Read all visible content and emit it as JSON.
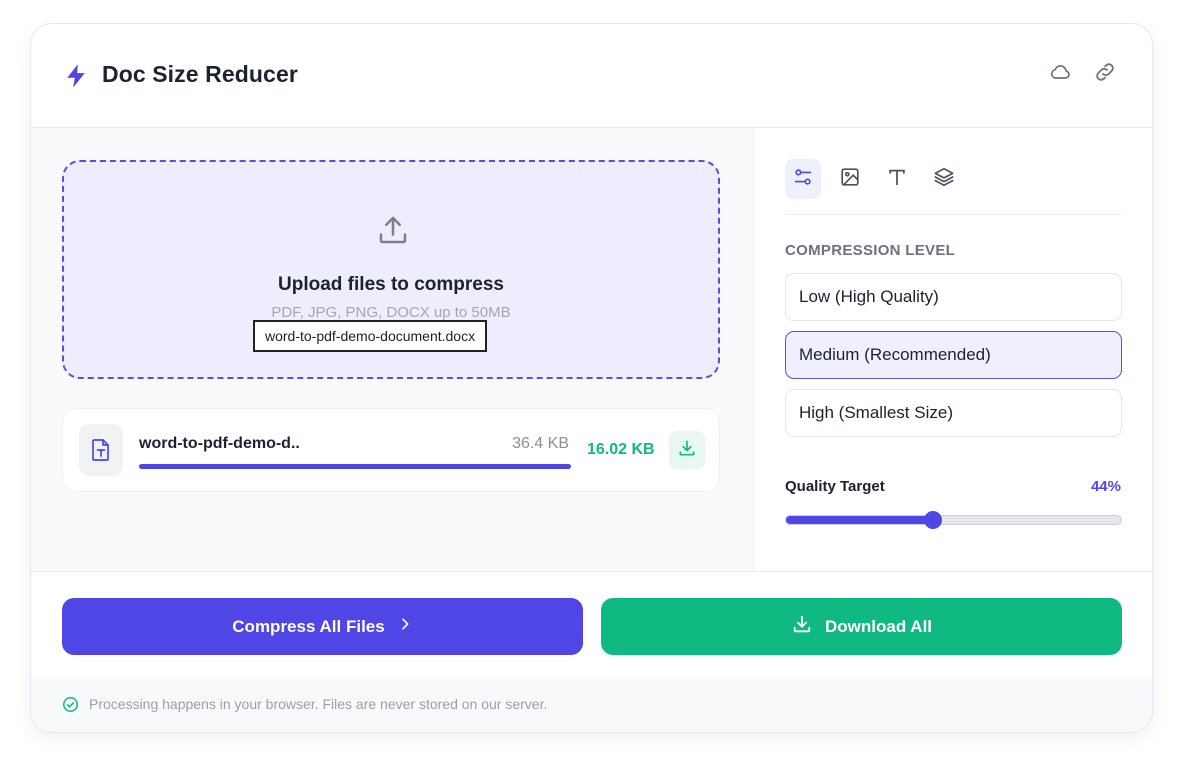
{
  "app": {
    "title": "Doc Size Reducer",
    "accent_color": "#4f46e5",
    "success_color": "#10b981",
    "header_icons": [
      "cloud-icon",
      "link-icon"
    ]
  },
  "upload": {
    "title": "Upload files to compress",
    "subtitle": "PDF, JPG, PNG, DOCX up to 50MB",
    "selected_file": "word-to-pdf-demo-document.docx"
  },
  "files": [
    {
      "name": "word-to-pdf-demo-d..",
      "original_size": "36.4 KB",
      "compressed_size": "16.02 KB",
      "progress_percent": 100
    }
  ],
  "settings": {
    "tabs": [
      "sliders-icon",
      "image-icon",
      "text-icon",
      "layers-icon"
    ],
    "active_tab": 0,
    "compression_label": "COMPRESSION LEVEL",
    "options": [
      "Low (High Quality)",
      "Medium (Recommended)",
      "High (Smallest Size)"
    ],
    "selected_option": 1,
    "quality_label": "Quality Target",
    "quality_value": "44%",
    "quality_percent": 44
  },
  "actions": {
    "compress_label": "Compress All Files",
    "download_label": "Download All"
  },
  "footer": {
    "text": "Processing happens in your browser. Files are never stored on our server."
  }
}
